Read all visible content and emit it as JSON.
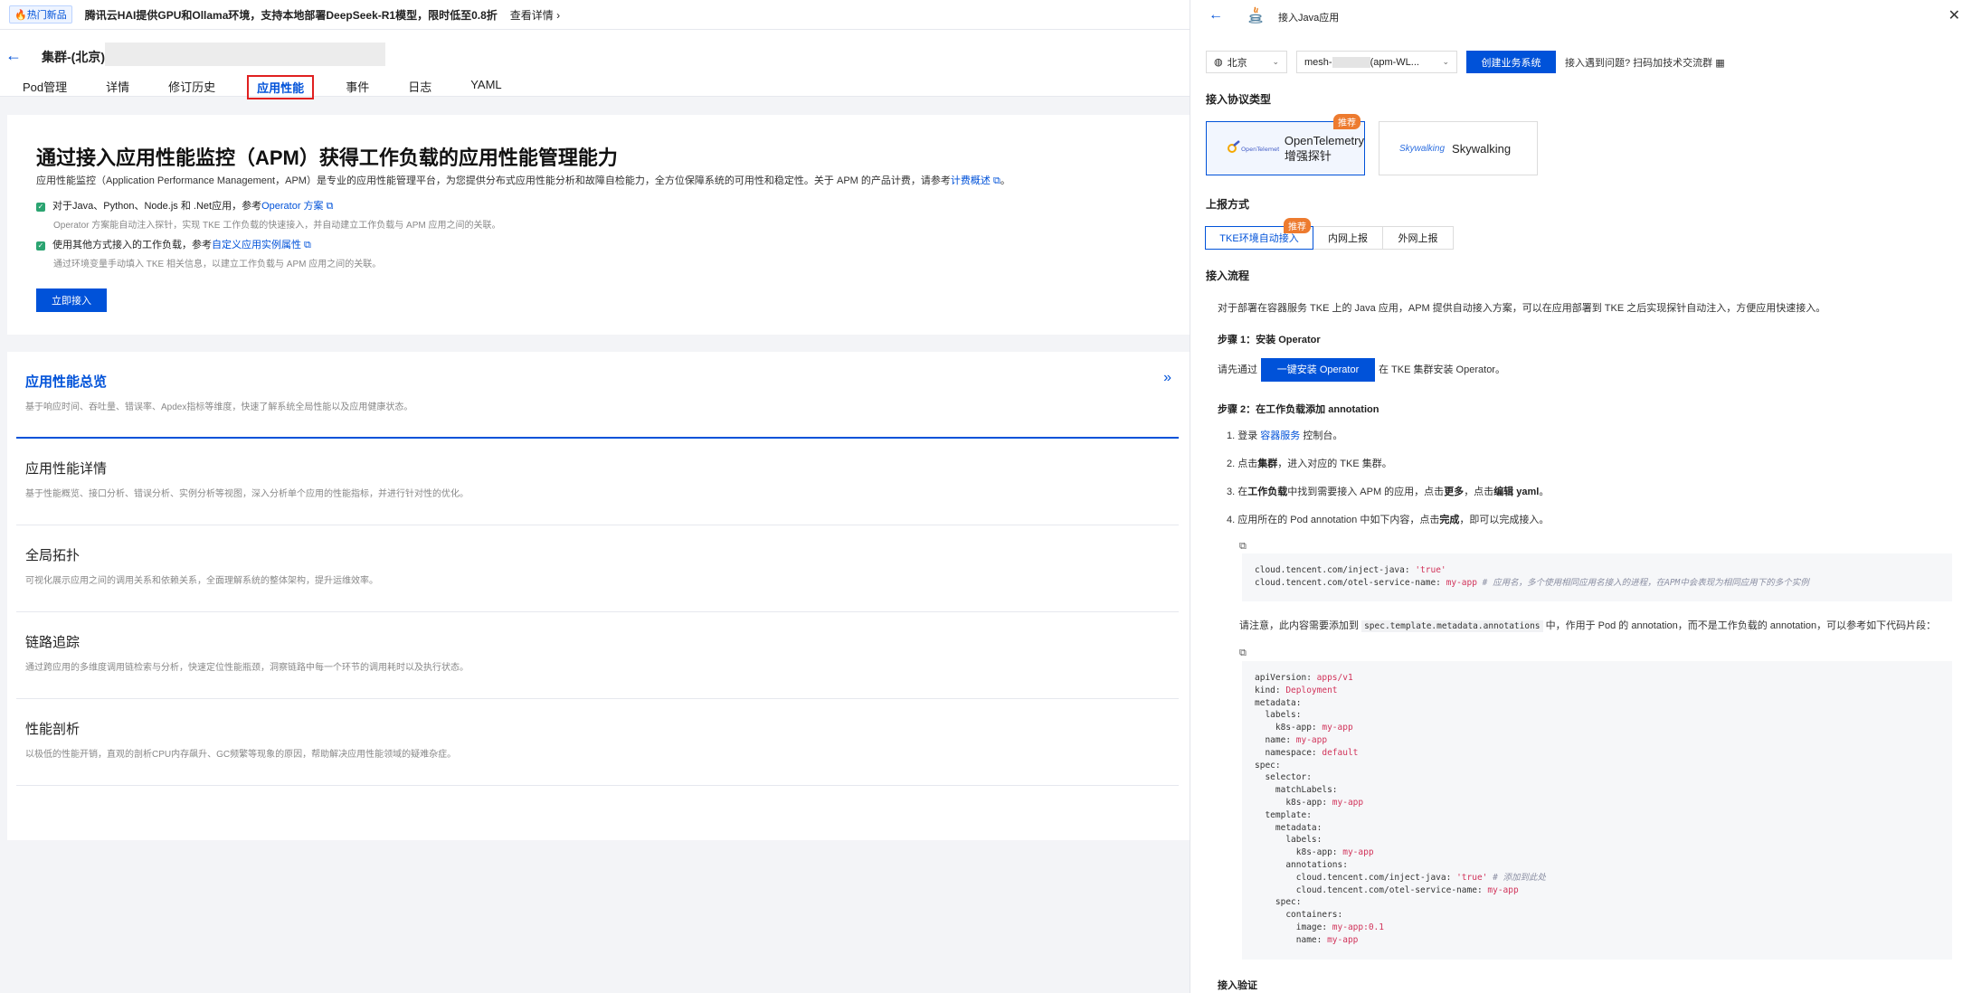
{
  "banner": {
    "badge": "🔥热门新品",
    "text": "腾讯云HAI提供GPU和Ollama环境，支持本地部署DeepSeek-R1模型，限时低至0.8折",
    "link": "查看详情 ›"
  },
  "header": {
    "back": "←",
    "cluster_title": "集群-(北京)",
    "tabs": [
      "Pod管理",
      "详情",
      "修订历史",
      "应用性能",
      "事件",
      "日志",
      "YAML"
    ],
    "active_tab": "应用性能"
  },
  "hero": {
    "title": "通过接入应用性能监控（APM）获得工作负载的应用性能管理能力",
    "desc_prefix": "应用性能监控（Application Performance Management，APM）是专业的应用性能管理平台，为您提供分布式应用性能分析和故障自检能力，全方位保障系统的可用性和稳定性。关于 APM 的产品计费，请参考",
    "desc_link": "计费概述",
    "desc_suffix": "。",
    "items": [
      {
        "main": "对于Java、Python、Node.js 和 .Net应用，参考",
        "link": "Operator 方案",
        "sub": "Operator 方案能自动注入探针，实现 TKE 工作负载的快速接入，并自动建立工作负载与 APM 应用之间的关联。"
      },
      {
        "main": "使用其他方式接入的工作负载，参考",
        "link": "自定义应用实例属性",
        "sub": "通过环境变量手动填入 TKE 相关信息，以建立工作负载与 APM 应用之间的关联。"
      }
    ],
    "button": "立即接入"
  },
  "features": [
    {
      "title": "应用性能总览",
      "desc": "基于响应时间、吞吐量、错误率、Apdex指标等维度，快速了解系统全局性能以及应用健康状态。",
      "arrow": "»"
    },
    {
      "title": "应用性能详情",
      "desc": "基于性能概览、接口分析、错误分析、实例分析等视图，深入分析单个应用的性能指标，并进行针对性的优化。"
    },
    {
      "title": "全局拓扑",
      "desc": "可视化展示应用之间的调用关系和依赖关系，全面理解系统的整体架构，提升运维效率。"
    },
    {
      "title": "链路追踪",
      "desc": "通过跨应用的多维度调用链检索与分析，快速定位性能瓶颈，洞察链路中每一个环节的调用耗时以及执行状态。"
    },
    {
      "title": "性能剖析",
      "desc": "以极低的性能开销，直观的剖析CPU内存飙升、GC频繁等现象的原因，帮助解决应用性能领域的疑难杂症。"
    }
  ],
  "drawer": {
    "title": "接入Java应用",
    "back": "←",
    "close": "✕",
    "region": "北京",
    "mesh_prefix": "mesh-",
    "mesh_suffix": "(apm-WL...",
    "create_button": "创建业务系统",
    "help": "接入遇到问题? 扫码加技术交流群",
    "protocol_title": "接入协议类型",
    "recommend": "推荐",
    "protocols": [
      {
        "label_line1": "OpenTelemetry",
        "label_line2": "增强探针",
        "logo": "OpenTelemetry"
      },
      {
        "label_line1": "Skywalking",
        "logo": "Skywalking"
      }
    ],
    "report_title": "上报方式",
    "report_modes": [
      "TKE环境自动接入",
      "内网上报",
      "外网上报"
    ],
    "flow_title": "接入流程",
    "flow_intro": "对于部署在容器服务 TKE 上的 Java 应用，APM 提供自动接入方案，可以在应用部署到 TKE 之后实现探针自动注入，方便应用快速接入。",
    "step1_title": "步骤 1：安装 Operator",
    "step1_prefix": "请先通过",
    "step1_button": "一键安装 Operator",
    "step1_suffix": "在 TKE 集群安装 Operator。",
    "step2_title": "步骤 2：在工作负载添加 annotation",
    "step2_items": {
      "i1_a": "1. 登录 ",
      "i1_link": "容器服务",
      "i1_b": " 控制台。",
      "i2_a": "2. 点击",
      "i2_b": "集群",
      "i2_c": "，进入对应的 TKE 集群。",
      "i3_a": "3. 在",
      "i3_b": "工作负载",
      "i3_c": "中找到需要接入 APM 的应用，点击",
      "i3_d": "更多",
      "i3_e": "，点击",
      "i3_f": "编辑 yaml",
      "i3_g": "。",
      "i4_a": "4. 应用所在的 Pod annotation 中如下内容，点击",
      "i4_b": "完成",
      "i4_c": "，即可以完成接入。"
    },
    "code1": {
      "l1_key": "cloud.tencent.com/inject-java: ",
      "l1_val": "'true'",
      "l2_key": "cloud.tencent.com/otel-service-name: ",
      "l2_val": "my-app",
      "l2_comment": " # 应用名，多个使用相同应用名接入的进程，在APM中会表现为相同应用下的多个实例"
    },
    "note_prefix": "请注意，此内容需要添加到 ",
    "note_code": "spec.template.metadata.annotations",
    "note_suffix": " 中，作用于 Pod 的 annotation，而不是工作负载的 annotation，可以参考如下代码片段：",
    "code2": [
      {
        "k": "apiVersion: ",
        "v": "apps/v1"
      },
      {
        "k": "kind: ",
        "v": "Deployment"
      },
      {
        "k": "metadata:",
        "v": ""
      },
      {
        "k": "  labels:",
        "v": ""
      },
      {
        "k": "    k8s-app: ",
        "v": "my-app"
      },
      {
        "k": "  name: ",
        "v": "my-app"
      },
      {
        "k": "  namespace: ",
        "v": "default"
      },
      {
        "k": "spec:",
        "v": ""
      },
      {
        "k": "  selector:",
        "v": ""
      },
      {
        "k": "    matchLabels:",
        "v": ""
      },
      {
        "k": "      k8s-app: ",
        "v": "my-app"
      },
      {
        "k": "  template:",
        "v": ""
      },
      {
        "k": "    metadata:",
        "v": ""
      },
      {
        "k": "      labels:",
        "v": ""
      },
      {
        "k": "        k8s-app: ",
        "v": "my-app"
      },
      {
        "k": "      annotations:",
        "v": ""
      },
      {
        "k": "        cloud.tencent.com/inject-java: ",
        "v": "'true'",
        "c": " # 添加到此处"
      },
      {
        "k": "        cloud.tencent.com/otel-service-name: ",
        "v": "my-app"
      },
      {
        "k": "    spec:",
        "v": ""
      },
      {
        "k": "      containers:",
        "v": ""
      },
      {
        "k": "        image: ",
        "v": "my-app:0.1"
      },
      {
        "k": "        name: ",
        "v": "my-app"
      }
    ],
    "verify_title": "接入验证"
  },
  "colors": {
    "primary": "#0052d9",
    "recommend": "#ed7b2f",
    "active_tab_outline": "#e02020"
  }
}
